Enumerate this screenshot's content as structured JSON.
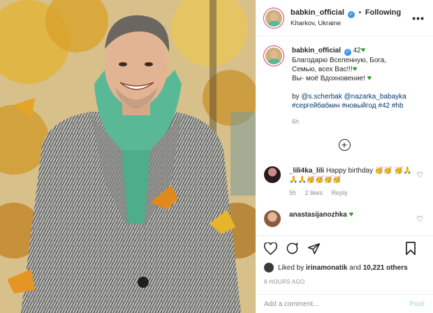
{
  "post": {
    "username": "babkin_official",
    "follow_status": "Following",
    "location": "Kharkov, Ukraine",
    "more_label": "•••",
    "caption": {
      "username": "babkin_official",
      "number": "42",
      "line1": "Благодарю Вселенную, Бога, Семью, всех Вас!!!",
      "line2": "Вы- моё Вдохновение!",
      "mention1": "@s.scherbak",
      "mention2": "@nazarka_babayka",
      "tag1": "#сергейбабкин",
      "tag2": "#новыйгод",
      "tag3": "#42",
      "tag4": "#hb",
      "by": "by",
      "time": "6h"
    },
    "load_more_label": "+",
    "comments": [
      {
        "username": "_lili4ka_lili",
        "text": "Happy birthday",
        "emojis": "🥳🥳 🥳🙏🙏🙏🥳🥳🥳🥳",
        "time": "5h",
        "likes": "2 likes",
        "reply": "Reply"
      },
      {
        "username": "anastasijanozhka",
        "text": "",
        "emojis": ""
      }
    ],
    "liked_by_prefix": "Liked by",
    "liked_by_user": "irinamonatik",
    "liked_by_and": "and",
    "liked_by_count": "10,221 others",
    "posted_ago": "8 HOURS AGO",
    "add_comment_placeholder": "Add a comment...",
    "post_button": "Post"
  },
  "colors": {
    "accent_link": "#00376b",
    "verified": "#3897f0",
    "hoodie": "#59b895",
    "heart_green": "#2aa52a"
  }
}
